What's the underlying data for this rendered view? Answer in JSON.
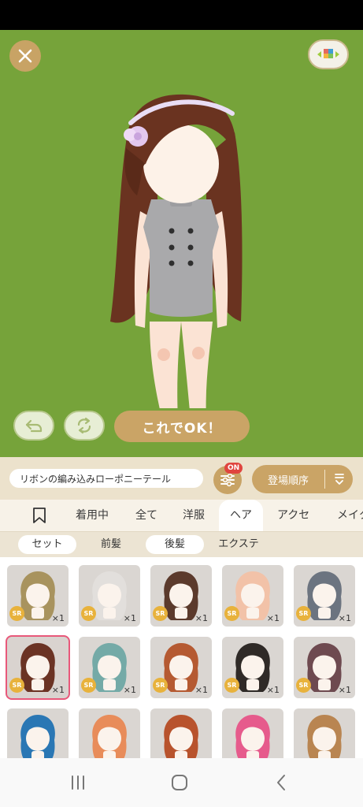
{
  "stage": {
    "ok_label": "これでOK！"
  },
  "item_bar": {
    "item_name": "リボンの編み込みローポニーテール",
    "filter_badge": "ON",
    "sort_label": "登場順序"
  },
  "tabs": [
    "着用中",
    "全て",
    "洋服",
    "ヘア",
    "アクセ",
    "メイク"
  ],
  "subtabs": [
    "セット",
    "前髪",
    "後髪",
    "エクステ"
  ],
  "grid": {
    "rarity": "SR",
    "count": "×1",
    "items": [
      {
        "hair": "#a8935e"
      },
      {
        "hair": "#e2dfdc"
      },
      {
        "hair": "#5b3a2c"
      },
      {
        "hair": "#f2c2a8"
      },
      {
        "hair": "#6c7480"
      },
      {
        "hair": "#6b3324"
      },
      {
        "hair": "#74aaa7"
      },
      {
        "hair": "#b55a32"
      },
      {
        "hair": "#2f2a27"
      },
      {
        "hair": "#6e4a50"
      },
      {
        "hair": "#2a77b4"
      },
      {
        "hair": "#e88c5a"
      },
      {
        "hair": "#b8532d"
      },
      {
        "hair": "#e65b8c"
      },
      {
        "hair": "#b98551"
      }
    ]
  },
  "colors": {
    "stage_bg": "#76a33a",
    "accent": "#caa466",
    "selected_border": "#e8587a",
    "badge_red": "#e0453f"
  }
}
